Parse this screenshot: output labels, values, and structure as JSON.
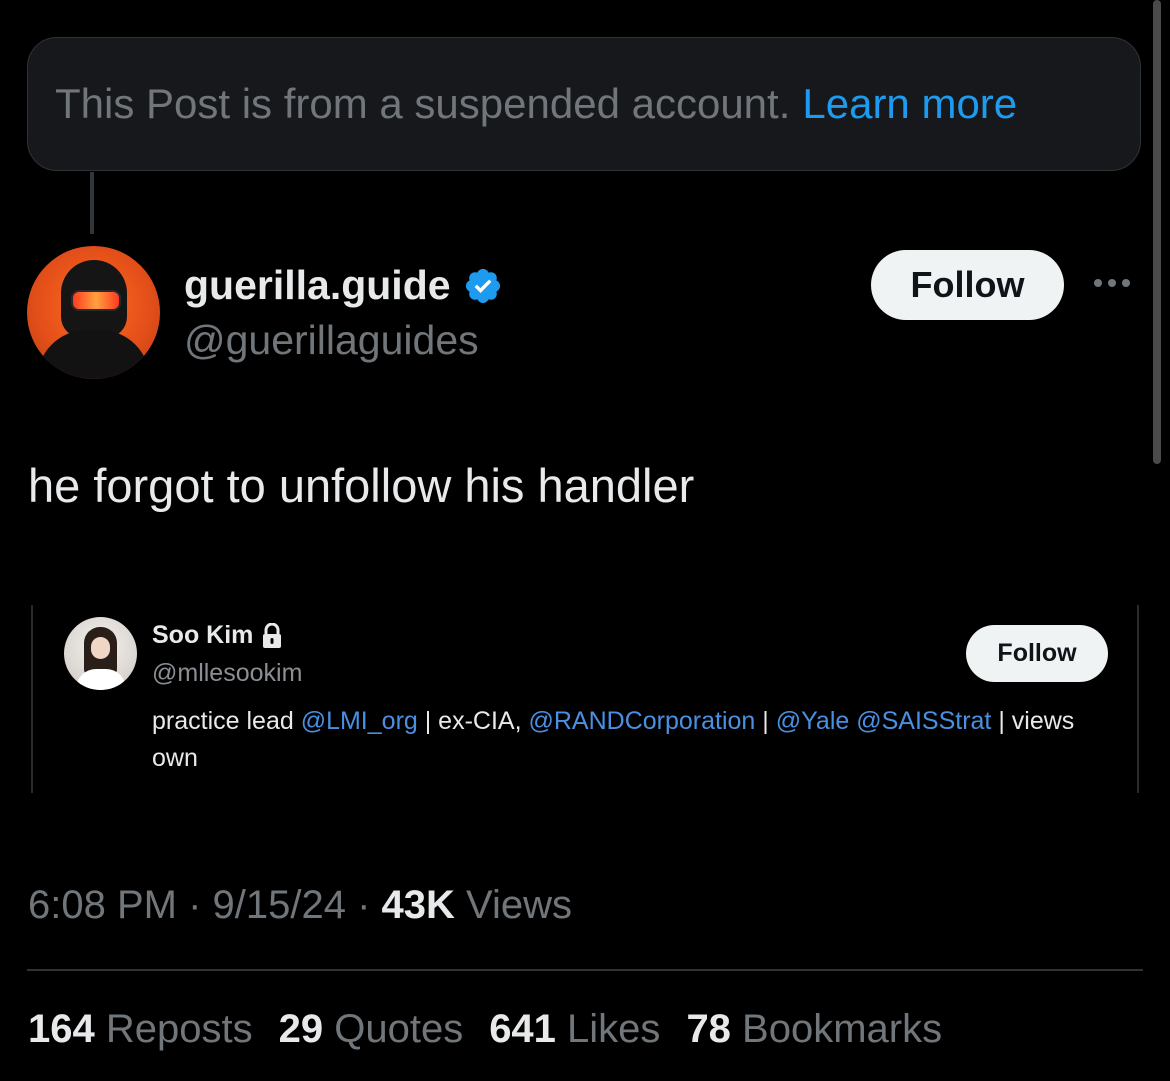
{
  "notice": {
    "text": "This Post is from a suspended account.",
    "link": "Learn more"
  },
  "author": {
    "name": "guerilla.guide",
    "handle": "@guerillaguides",
    "verified": true,
    "follow_label": "Follow"
  },
  "post": {
    "text": "he forgot to unfollow his handler"
  },
  "embed": {
    "name": "Soo Kim",
    "handle": "@mllesookim",
    "follow_label": "Follow",
    "bio": {
      "t1": "practice lead ",
      "m1": "@LMI_org",
      "t2": " | ex-CIA, ",
      "m2": "@RANDCorporation",
      "t3": " | ",
      "m3": "@Yale",
      "t4": " ",
      "m4": "@SAISStrat",
      "t5": " | views own"
    }
  },
  "meta": {
    "time": "6:08 PM",
    "sep1": " · ",
    "date": "9/15/24",
    "sep2": " · ",
    "views_count": "43K",
    "views_label": " Views"
  },
  "stats": [
    {
      "count": "164",
      "label": " Reposts"
    },
    {
      "count": "29",
      "label": " Quotes"
    },
    {
      "count": "641",
      "label": " Likes"
    },
    {
      "count": "78",
      "label": " Bookmarks"
    }
  ],
  "colors": {
    "background": "#000000",
    "link": "#1d9bf0",
    "muted": "#71767b",
    "text": "#e7e9ea"
  }
}
